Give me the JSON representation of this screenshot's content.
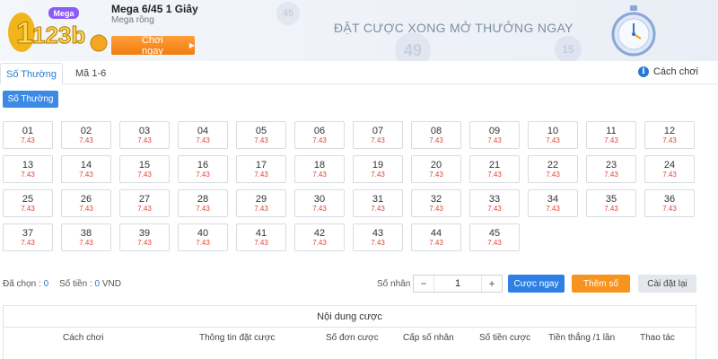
{
  "header": {
    "logo_text": "123b",
    "logo_badge": "Mega",
    "game_title": "Mega 6/45 1 Giây",
    "game_sub": "Mega rồng",
    "play_button": "Chơi ngay",
    "slogan": "ĐẶT CƯỢC XONG MỞ THƯỞNG NGAY",
    "background_balls": [
      "49",
      "45",
      "15"
    ],
    "colors": {
      "accent": "#2a7ad5",
      "orange": "#f7941d",
      "odds": "#e0463a"
    }
  },
  "tabs": [
    {
      "label": "Số Thường",
      "active": true
    },
    {
      "label": "Mã 1-6",
      "active": false
    }
  ],
  "how_to_play": {
    "icon": "info-icon",
    "label": "Cách chơi"
  },
  "subtab": {
    "label": "Số Thường"
  },
  "numbers": [
    {
      "num": "01",
      "odds": "7.43"
    },
    {
      "num": "02",
      "odds": "7.43"
    },
    {
      "num": "03",
      "odds": "7.43"
    },
    {
      "num": "04",
      "odds": "7.43"
    },
    {
      "num": "05",
      "odds": "7.43"
    },
    {
      "num": "06",
      "odds": "7.43"
    },
    {
      "num": "07",
      "odds": "7.43"
    },
    {
      "num": "08",
      "odds": "7.43"
    },
    {
      "num": "09",
      "odds": "7.43"
    },
    {
      "num": "10",
      "odds": "7.43"
    },
    {
      "num": "11",
      "odds": "7.43"
    },
    {
      "num": "12",
      "odds": "7.43"
    },
    {
      "num": "13",
      "odds": "7.43"
    },
    {
      "num": "14",
      "odds": "7.43"
    },
    {
      "num": "15",
      "odds": "7.43"
    },
    {
      "num": "16",
      "odds": "7.43"
    },
    {
      "num": "17",
      "odds": "7.43"
    },
    {
      "num": "18",
      "odds": "7.43"
    },
    {
      "num": "19",
      "odds": "7.43"
    },
    {
      "num": "20",
      "odds": "7.43"
    },
    {
      "num": "21",
      "odds": "7.43"
    },
    {
      "num": "22",
      "odds": "7.43"
    },
    {
      "num": "23",
      "odds": "7.43"
    },
    {
      "num": "24",
      "odds": "7.43"
    },
    {
      "num": "25",
      "odds": "7.43"
    },
    {
      "num": "26",
      "odds": "7.43"
    },
    {
      "num": "27",
      "odds": "7.43"
    },
    {
      "num": "28",
      "odds": "7.43"
    },
    {
      "num": "29",
      "odds": "7.43"
    },
    {
      "num": "30",
      "odds": "7.43"
    },
    {
      "num": "31",
      "odds": "7.43"
    },
    {
      "num": "32",
      "odds": "7.43"
    },
    {
      "num": "33",
      "odds": "7.43"
    },
    {
      "num": "34",
      "odds": "7.43"
    },
    {
      "num": "35",
      "odds": "7.43"
    },
    {
      "num": "36",
      "odds": "7.43"
    },
    {
      "num": "37",
      "odds": "7.43"
    },
    {
      "num": "38",
      "odds": "7.43"
    },
    {
      "num": "39",
      "odds": "7.43"
    },
    {
      "num": "40",
      "odds": "7.43"
    },
    {
      "num": "41",
      "odds": "7.43"
    },
    {
      "num": "42",
      "odds": "7.43"
    },
    {
      "num": "43",
      "odds": "7.43"
    },
    {
      "num": "44",
      "odds": "7.43"
    },
    {
      "num": "45",
      "odds": "7.43"
    }
  ],
  "summary": {
    "selected_label": "Đã chọn :",
    "selected_value": "0",
    "amount_label": "Số tiền :",
    "amount_value": "0",
    "currency": "VND",
    "multiplier_label": "Số nhân :",
    "multiplier_value": "1",
    "minus": "−",
    "plus": "+",
    "bet_now": "Cược ngay",
    "add_number": "Thêm số",
    "reset": "Cài đặt lại"
  },
  "bet_table": {
    "title": "Nội dung cược",
    "columns": [
      "Cách chơi",
      "Thông tin đặt cược",
      "Số đơn cược",
      "Cấp số nhân",
      "Số tiền cược",
      "Tiền thắng /1 lần",
      "Thao tác"
    ]
  }
}
